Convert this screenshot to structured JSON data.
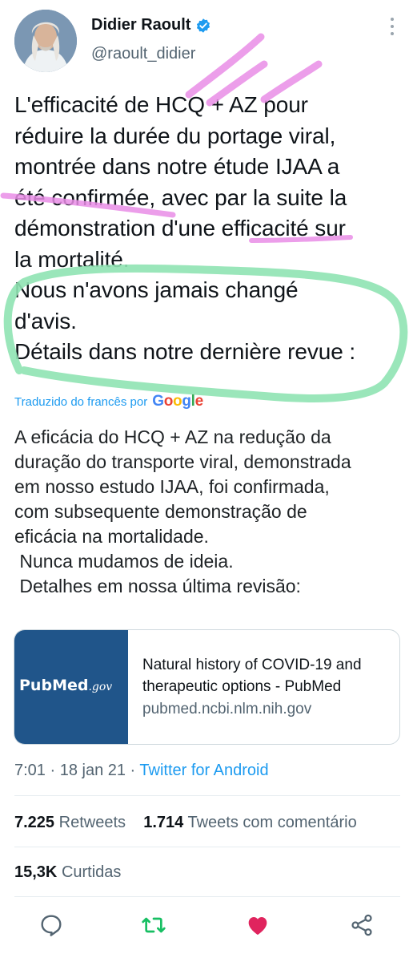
{
  "author": {
    "name": "Didier Raoult",
    "handle": "@raoult_didier",
    "verified": true
  },
  "tweet": {
    "lines": [
      "L'efficacité de HCQ + AZ pour",
      "réduire la durée du portage viral,",
      "montrée dans notre étude IJAA a",
      "été confirmée, avec par la suite la",
      "démonstration d'une efficacité sur",
      "la mortalité.",
      "Nous n'avons jamais changé",
      "d'avis.",
      "Détails dans notre dernière revue :"
    ]
  },
  "translation": {
    "credit": "Traduzido do francês por",
    "provider": "Google",
    "lines": [
      "A eficácia do HCQ + AZ na redução da",
      "duração do transporte viral, demonstrada",
      "em nosso estudo IJAA, foi confirmada,",
      "com subsequente demonstração de",
      "eficácia na mortalidade.",
      " Nunca mudamos de ideia.",
      " Detalhes em nossa última revisão:"
    ]
  },
  "link_card": {
    "logo_text": "Pub",
    "logo_text2": "Med",
    "logo_suffix": ".gov",
    "title": "Natural history of COVID-19 and therapeutic options - PubMed",
    "domain": "pubmed.ncbi.nlm.nih.gov"
  },
  "meta": {
    "time_date": "7:01 · 18 jan 21 · ",
    "client": "Twitter for Android"
  },
  "stats": {
    "retweets_count": "7.225",
    "retweets_label": "Retweets",
    "quotes_count": "1.714",
    "quotes_label": "Tweets com comentário",
    "likes_count": "15,3K",
    "likes_label": "Curtidas"
  },
  "icons": [
    "verified-badge-icon",
    "more-options-icon",
    "reply-icon",
    "retweet-icon",
    "like-icon",
    "share-icon"
  ],
  "colors": {
    "accent": "#1d9bf0",
    "retweet_green": "#17bf63",
    "like_red": "#e0245e",
    "pink_annotation": "#e98de6",
    "green_annotation": "#8fe3b3",
    "pubmed_blue": "#20558a"
  }
}
